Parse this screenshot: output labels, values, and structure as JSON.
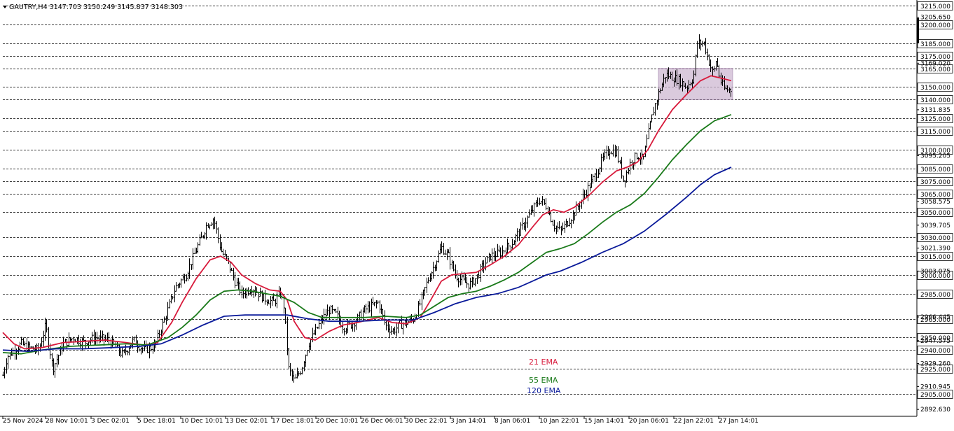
{
  "header": {
    "symbol_text": "GAUTRY,H4  3147.703 3150.249 3145.837 3148.303"
  },
  "legend": [
    {
      "label": "21 EMA",
      "color": "#d81b3c"
    },
    {
      "label": "55 EMA",
      "color": "#1a7a1a"
    },
    {
      "label": "120 EMA",
      "color": "#0a1a9a"
    }
  ],
  "chart_data": {
    "type": "ohlc",
    "symbol": "GAUTRY",
    "timeframe": "H4",
    "ylim": [
      2890,
      3220
    ],
    "grid": "dashed horizontal",
    "y_ticks_plain": [
      3205.65,
      3169.02,
      3131.835,
      3095.205,
      3058.575,
      3039.705,
      3021.39,
      3003.075,
      2966.445,
      2947.575,
      2929.26,
      2910.945,
      2892.63
    ],
    "y_ticks_plain_labels": [
      "3205.650",
      "3169.020",
      "3131.835",
      "3095.205",
      "3058.575",
      "3039.705",
      "3021.390",
      "3003.075",
      "2966.445",
      "2947.575",
      "2929.260",
      "2910.945",
      "2892.630"
    ],
    "y_level_lines": [
      3215,
      3200,
      3185,
      3175,
      3165,
      3150,
      3140,
      3125,
      3115,
      3100,
      3085,
      3075,
      3065,
      3050,
      3030,
      3015,
      3000,
      2985,
      2965,
      2950,
      2940,
      2925,
      2905
    ],
    "y_level_labels": [
      "3215.000",
      "3200.000",
      "3185.000",
      "3175.000",
      "3165.000",
      "3150.000",
      "3140.000",
      "3125.000",
      "3115.000",
      "3100.000",
      "3085.000",
      "3075.000",
      "3065.000",
      "3050.000",
      "3030.000",
      "3015.000",
      "3000.000",
      "2985.000",
      "2965.000",
      "2950.000",
      "2940.000",
      "2925.000",
      "2905.000"
    ],
    "x_tick_labels": [
      "25 Nov 2024",
      "28 Nov 10:01",
      "3 Dec 02:01",
      "5 Dec 18:01",
      "10 Dec 10:01",
      "13 Dec 02:01",
      "17 Dec 18:01",
      "20 Dec 10:01",
      "26 Dec 06:01",
      "30 Dec 22:01",
      "3 Jan 14:01",
      "8 Jan 06:01",
      "10 Jan 22:01",
      "15 Jan 14:01",
      "20 Jan 06:01",
      "22 Jan 22:01",
      "27 Jan 14:01"
    ],
    "price_anchors": [
      [
        0,
        2910
      ],
      [
        10,
        2935
      ],
      [
        20,
        2940
      ],
      [
        30,
        2945
      ],
      [
        40,
        2942
      ],
      [
        55,
        2940
      ],
      [
        65,
        2960
      ],
      [
        75,
        2925
      ],
      [
        90,
        2945
      ],
      [
        105,
        2950
      ],
      [
        120,
        2946
      ],
      [
        135,
        2950
      ],
      [
        155,
        2948
      ],
      [
        175,
        2936
      ],
      [
        190,
        2948
      ],
      [
        205,
        2940
      ],
      [
        220,
        2943
      ],
      [
        235,
        2965
      ],
      [
        250,
        2990
      ],
      [
        265,
        3000
      ],
      [
        280,
        3020
      ],
      [
        295,
        3040
      ],
      [
        305,
        3045
      ],
      [
        315,
        3020
      ],
      [
        325,
        3010
      ],
      [
        335,
        2995
      ],
      [
        345,
        2985
      ],
      [
        360,
        2990
      ],
      [
        375,
        2982
      ],
      [
        390,
        2978
      ],
      [
        400,
        2985
      ],
      [
        405,
        2975
      ],
      [
        412,
        2925
      ],
      [
        420,
        2915
      ],
      [
        430,
        2925
      ],
      [
        440,
        2945
      ],
      [
        450,
        2955
      ],
      [
        460,
        2965
      ],
      [
        470,
        2972
      ],
      [
        480,
        2968
      ],
      [
        490,
        2958
      ],
      [
        500,
        2960
      ],
      [
        510,
        2965
      ],
      [
        520,
        2972
      ],
      [
        530,
        2975
      ],
      [
        540,
        2978
      ],
      [
        550,
        2960
      ],
      [
        560,
        2955
      ],
      [
        570,
        2960
      ],
      [
        580,
        2962
      ],
      [
        590,
        2965
      ],
      [
        600,
        2978
      ],
      [
        610,
        2995
      ],
      [
        620,
        3008
      ],
      [
        630,
        3022
      ],
      [
        640,
        3015
      ],
      [
        650,
        3000
      ],
      [
        660,
        2995
      ],
      [
        670,
        2992
      ],
      [
        680,
        2998
      ],
      [
        690,
        3008
      ],
      [
        700,
        3015
      ],
      [
        715,
        3018
      ],
      [
        730,
        3025
      ],
      [
        745,
        3038
      ],
      [
        760,
        3052
      ],
      [
        770,
        3060
      ],
      [
        780,
        3055
      ],
      [
        790,
        3040
      ],
      [
        800,
        3035
      ],
      [
        810,
        3042
      ],
      [
        820,
        3050
      ],
      [
        830,
        3060
      ],
      [
        840,
        3070
      ],
      [
        850,
        3080
      ],
      [
        860,
        3092
      ],
      [
        870,
        3100
      ],
      [
        880,
        3098
      ],
      [
        890,
        3075
      ],
      [
        900,
        3090
      ],
      [
        910,
        3096
      ],
      [
        918,
        3092
      ],
      [
        925,
        3112
      ],
      [
        932,
        3130
      ],
      [
        940,
        3145
      ],
      [
        950,
        3160
      ],
      [
        960,
        3158
      ],
      [
        970,
        3155
      ],
      [
        980,
        3150
      ],
      [
        990,
        3158
      ],
      [
        995,
        3185
      ],
      [
        1005,
        3185
      ],
      [
        1012,
        3170
      ],
      [
        1018,
        3160
      ],
      [
        1022,
        3172
      ],
      [
        1028,
        3155
      ],
      [
        1034,
        3148
      ],
      [
        1042,
        3148
      ]
    ],
    "ema_21": [
      [
        4,
        2954
      ],
      [
        20,
        2945
      ],
      [
        35,
        2941
      ],
      [
        60,
        2942
      ],
      [
        90,
        2946
      ],
      [
        120,
        2947
      ],
      [
        150,
        2948
      ],
      [
        180,
        2946
      ],
      [
        205,
        2944
      ],
      [
        225,
        2946
      ],
      [
        245,
        2962
      ],
      [
        260,
        2978
      ],
      [
        280,
        2997
      ],
      [
        300,
        3012
      ],
      [
        315,
        3015
      ],
      [
        330,
        3010
      ],
      [
        345,
        3000
      ],
      [
        365,
        2993
      ],
      [
        385,
        2988
      ],
      [
        400,
        2987
      ],
      [
        410,
        2980
      ],
      [
        420,
        2963
      ],
      [
        435,
        2950
      ],
      [
        450,
        2948
      ],
      [
        470,
        2955
      ],
      [
        490,
        2960
      ],
      [
        510,
        2962
      ],
      [
        540,
        2966
      ],
      [
        560,
        2962
      ],
      [
        580,
        2961
      ],
      [
        600,
        2966
      ],
      [
        615,
        2980
      ],
      [
        630,
        2995
      ],
      [
        645,
        3000
      ],
      [
        660,
        3001
      ],
      [
        680,
        3002
      ],
      [
        700,
        3008
      ],
      [
        720,
        3015
      ],
      [
        740,
        3024
      ],
      [
        760,
        3038
      ],
      [
        775,
        3048
      ],
      [
        790,
        3052
      ],
      [
        805,
        3050
      ],
      [
        820,
        3054
      ],
      [
        840,
        3063
      ],
      [
        860,
        3074
      ],
      [
        880,
        3083
      ],
      [
        895,
        3086
      ],
      [
        910,
        3090
      ],
      [
        925,
        3100
      ],
      [
        940,
        3115
      ],
      [
        960,
        3132
      ],
      [
        980,
        3144
      ],
      [
        1000,
        3155
      ],
      [
        1015,
        3159
      ],
      [
        1030,
        3157
      ],
      [
        1044,
        3155
      ]
    ],
    "ema_55": [
      [
        4,
        2938
      ],
      [
        30,
        2937
      ],
      [
        60,
        2940
      ],
      [
        100,
        2943
      ],
      [
        140,
        2944
      ],
      [
        180,
        2945
      ],
      [
        210,
        2944
      ],
      [
        240,
        2950
      ],
      [
        260,
        2958
      ],
      [
        280,
        2968
      ],
      [
        300,
        2980
      ],
      [
        320,
        2987
      ],
      [
        340,
        2988
      ],
      [
        360,
        2987
      ],
      [
        380,
        2985
      ],
      [
        400,
        2983
      ],
      [
        420,
        2978
      ],
      [
        440,
        2970
      ],
      [
        460,
        2966
      ],
      [
        490,
        2966
      ],
      [
        520,
        2966
      ],
      [
        550,
        2967
      ],
      [
        580,
        2966
      ],
      [
        600,
        2968
      ],
      [
        620,
        2975
      ],
      [
        640,
        2982
      ],
      [
        660,
        2985
      ],
      [
        680,
        2987
      ],
      [
        700,
        2991
      ],
      [
        720,
        2996
      ],
      [
        740,
        3002
      ],
      [
        760,
        3010
      ],
      [
        780,
        3018
      ],
      [
        800,
        3021
      ],
      [
        820,
        3025
      ],
      [
        840,
        3033
      ],
      [
        860,
        3042
      ],
      [
        880,
        3050
      ],
      [
        900,
        3056
      ],
      [
        920,
        3065
      ],
      [
        940,
        3078
      ],
      [
        960,
        3092
      ],
      [
        980,
        3104
      ],
      [
        1000,
        3115
      ],
      [
        1020,
        3123
      ],
      [
        1044,
        3128
      ]
    ],
    "ema_120": [
      [
        4,
        2940
      ],
      [
        40,
        2939
      ],
      [
        80,
        2941
      ],
      [
        120,
        2941
      ],
      [
        160,
        2942
      ],
      [
        200,
        2943
      ],
      [
        230,
        2945
      ],
      [
        260,
        2952
      ],
      [
        290,
        2960
      ],
      [
        320,
        2967
      ],
      [
        350,
        2968
      ],
      [
        380,
        2968
      ],
      [
        410,
        2968
      ],
      [
        440,
        2965
      ],
      [
        470,
        2963
      ],
      [
        510,
        2963
      ],
      [
        550,
        2964
      ],
      [
        590,
        2964
      ],
      [
        620,
        2970
      ],
      [
        650,
        2977
      ],
      [
        680,
        2982
      ],
      [
        710,
        2985
      ],
      [
        740,
        2990
      ],
      [
        760,
        2995
      ],
      [
        780,
        3000
      ],
      [
        800,
        3003
      ],
      [
        830,
        3010
      ],
      [
        860,
        3018
      ],
      [
        890,
        3025
      ],
      [
        920,
        3035
      ],
      [
        950,
        3048
      ],
      [
        980,
        3062
      ],
      [
        1000,
        3072
      ],
      [
        1020,
        3080
      ],
      [
        1044,
        3086
      ]
    ],
    "zone": {
      "low": 3140,
      "high": 3165
    }
  }
}
